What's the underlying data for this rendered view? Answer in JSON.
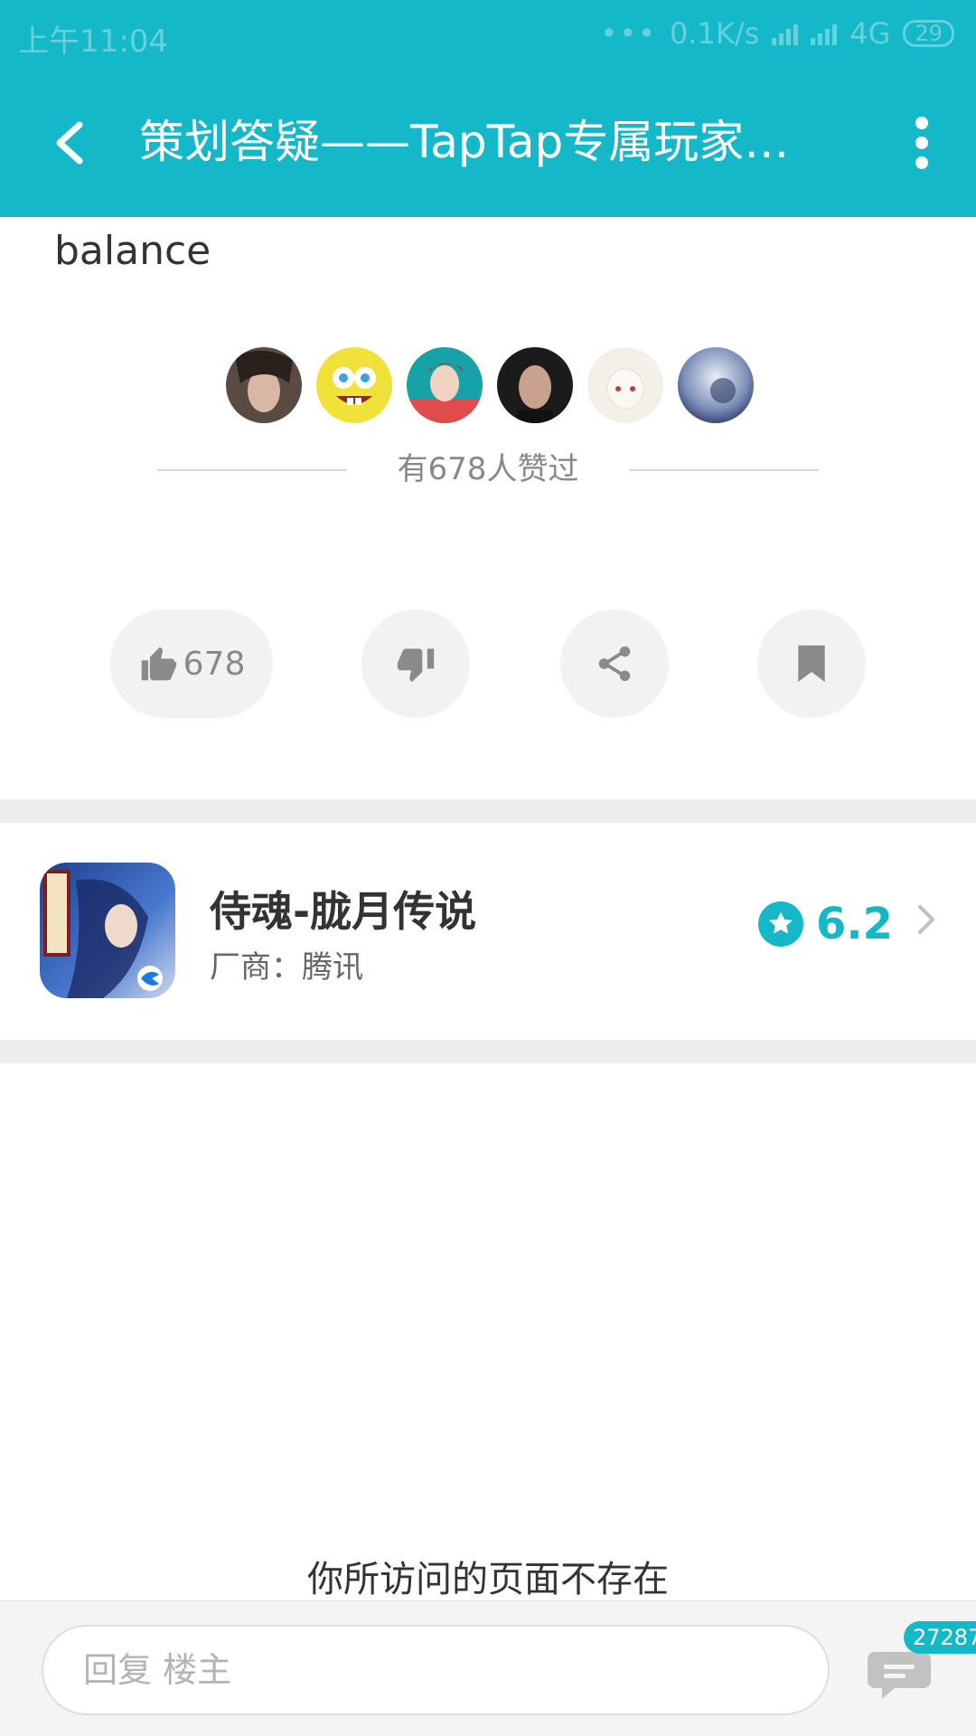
{
  "status_bar": {
    "time": "上午11:04",
    "dots": "•••",
    "net_speed": "0.1K/s",
    "network": "4G",
    "battery": "29"
  },
  "app_bar": {
    "back_icon": "back-arrow-icon",
    "title": "策划答疑——TapTap专属玩家…",
    "more_icon": "more-vertical-icon"
  },
  "post": {
    "text": "balance",
    "likers_text": "有678人赞过",
    "avatars": [
      "avatar-1",
      "avatar-2",
      "avatar-3",
      "avatar-4",
      "avatar-5",
      "avatar-6"
    ]
  },
  "actions": {
    "like_count": "678",
    "like_icon": "thumbs-up-icon",
    "dislike_icon": "thumbs-down-icon",
    "share_icon": "share-icon",
    "bookmark_icon": "bookmark-icon"
  },
  "game": {
    "name": "侍魂-胧月传说",
    "vendor": "厂商：腾讯",
    "score": "6.2"
  },
  "page_message": "你所访问的页面不存在",
  "bottom_bar": {
    "reply_placeholder": "回复  楼主",
    "comment_count": "27287"
  },
  "colors": {
    "brand": "#15b8c8",
    "background": "#ffffff",
    "divider": "#eeeeee"
  }
}
